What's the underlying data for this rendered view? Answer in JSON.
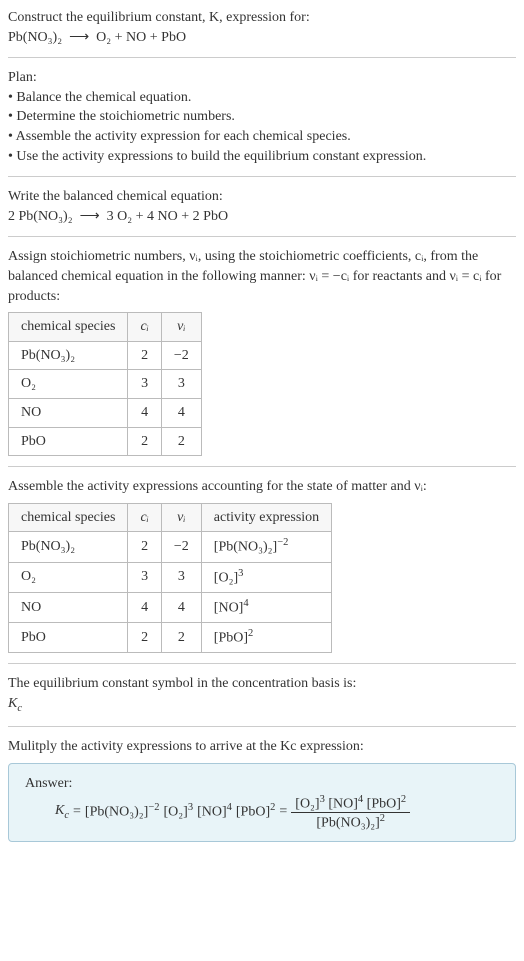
{
  "intro": {
    "line1": "Construct the equilibrium constant, K, expression for:",
    "eq_lhs": "Pb(NO₃)₂",
    "arrow": "⟶",
    "eq_rhs": "O₂ + NO + PbO"
  },
  "plan": {
    "title": "Plan:",
    "items": [
      "• Balance the chemical equation.",
      "• Determine the stoichiometric numbers.",
      "• Assemble the activity expression for each chemical species.",
      "• Use the activity expressions to build the equilibrium constant expression."
    ]
  },
  "balanced": {
    "title": "Write the balanced chemical equation:",
    "eq_lhs": "2 Pb(NO₃)₂",
    "arrow": "⟶",
    "eq_rhs": "3 O₂ + 4 NO + 2 PbO"
  },
  "stoich": {
    "intro_a": "Assign stoichiometric numbers, νᵢ, using the stoichiometric coefficients, cᵢ, from the balanced chemical equation in the following manner: νᵢ = −cᵢ for reactants and νᵢ = cᵢ for products:",
    "headers": [
      "chemical species",
      "cᵢ",
      "νᵢ"
    ],
    "rows": [
      {
        "sp": "Pb(NO₃)₂",
        "c": "2",
        "v": "−2"
      },
      {
        "sp": "O₂",
        "c": "3",
        "v": "3"
      },
      {
        "sp": "NO",
        "c": "4",
        "v": "4"
      },
      {
        "sp": "PbO",
        "c": "2",
        "v": "2"
      }
    ]
  },
  "activity": {
    "intro": "Assemble the activity expressions accounting for the state of matter and νᵢ:",
    "headers": [
      "chemical species",
      "cᵢ",
      "νᵢ",
      "activity expression"
    ],
    "rows": [
      {
        "sp": "Pb(NO₃)₂",
        "c": "2",
        "v": "−2",
        "ae_base": "[Pb(NO₃)₂]",
        "ae_sup": "−2"
      },
      {
        "sp": "O₂",
        "c": "3",
        "v": "3",
        "ae_base": "[O₂]",
        "ae_sup": "3"
      },
      {
        "sp": "NO",
        "c": "4",
        "v": "4",
        "ae_base": "[NO]",
        "ae_sup": "4"
      },
      {
        "sp": "PbO",
        "c": "2",
        "v": "2",
        "ae_base": "[PbO]",
        "ae_sup": "2"
      }
    ]
  },
  "symbol": {
    "line1": "The equilibrium constant symbol in the concentration basis is:",
    "k": "K",
    "ksub": "c"
  },
  "multiply": {
    "line": "Mulitply the activity expressions to arrive at the Kc expression:"
  },
  "answer": {
    "label": "Answer:",
    "k": "K",
    "ksub": "c",
    "eq_sign": " = ",
    "t1_base": "[Pb(NO₃)₂]",
    "t1_sup": "−2",
    "t2_base": "[O₂]",
    "t2_sup": "3",
    "t3_base": "[NO]",
    "t3_sup": "4",
    "t4_base": "[PbO]",
    "t4_sup": "2",
    "eq_sign2": " = ",
    "num_t1_base": "[O₂]",
    "num_t1_sup": "3",
    "num_t2_base": "[NO]",
    "num_t2_sup": "4",
    "num_t3_base": "[PbO]",
    "num_t3_sup": "2",
    "den_base": "[Pb(NO₃)₂]",
    "den_sup": "2"
  }
}
